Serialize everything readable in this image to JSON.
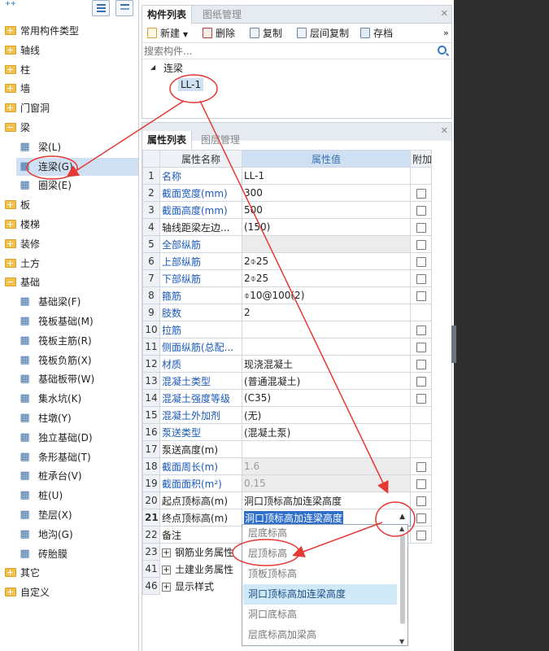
{
  "left_tree": {
    "items": [
      {
        "label": "常用构件类型",
        "kind": "folder-collapsed"
      },
      {
        "label": "轴线",
        "kind": "folder-collapsed"
      },
      {
        "label": "柱",
        "kind": "folder-collapsed"
      },
      {
        "label": "墙",
        "kind": "folder-collapsed"
      },
      {
        "label": "门窗洞",
        "kind": "folder-collapsed"
      },
      {
        "label": "梁",
        "kind": "folder-expanded"
      },
      {
        "label": "梁(L)",
        "kind": "child",
        "icon": "beam-icon"
      },
      {
        "label": "连梁(G)",
        "kind": "child",
        "icon": "link-beam-icon",
        "selected": true
      },
      {
        "label": "圈梁(E)",
        "kind": "child",
        "icon": "ring-beam-icon"
      },
      {
        "label": "板",
        "kind": "folder-collapsed"
      },
      {
        "label": "楼梯",
        "kind": "folder-collapsed"
      },
      {
        "label": "装修",
        "kind": "folder-collapsed"
      },
      {
        "label": "土方",
        "kind": "folder-collapsed"
      },
      {
        "label": "基础",
        "kind": "folder-expanded"
      },
      {
        "label": "基础梁(F)",
        "kind": "child",
        "icon": "foundation-beam-icon"
      },
      {
        "label": "筏板基础(M)",
        "kind": "child",
        "icon": "raft-foundation-icon"
      },
      {
        "label": "筏板主筋(R)",
        "kind": "child",
        "icon": "raft-main-rebar-icon"
      },
      {
        "label": "筏板负筋(X)",
        "kind": "child",
        "icon": "raft-negative-rebar-icon"
      },
      {
        "label": "基础板带(W)",
        "kind": "child",
        "icon": "foundation-strip-icon"
      },
      {
        "label": "集水坑(K)",
        "kind": "child",
        "icon": "sump-pit-icon"
      },
      {
        "label": "柱墩(Y)",
        "kind": "child",
        "icon": "column-pier-icon"
      },
      {
        "label": "独立基础(D)",
        "kind": "child",
        "icon": "isolated-footing-icon"
      },
      {
        "label": "条形基础(T)",
        "kind": "child",
        "icon": "strip-footing-icon"
      },
      {
        "label": "桩承台(V)",
        "kind": "child",
        "icon": "pile-cap-icon"
      },
      {
        "label": "桩(U)",
        "kind": "child",
        "icon": "pile-icon"
      },
      {
        "label": "垫层(X)",
        "kind": "child",
        "icon": "cushion-icon"
      },
      {
        "label": "地沟(G)",
        "kind": "child",
        "icon": "trench-icon"
      },
      {
        "label": "砖胎膜",
        "kind": "child",
        "icon": "brick-mold-icon"
      },
      {
        "label": "其它",
        "kind": "folder-collapsed"
      },
      {
        "label": "自定义",
        "kind": "folder-collapsed"
      }
    ]
  },
  "component_panel": {
    "tabs": [
      "构件列表",
      "图纸管理"
    ],
    "toolbar": {
      "new": "新建",
      "delete": "删除",
      "copy": "复制",
      "floor_copy": "层间复制",
      "archive": "存档",
      "more": "»"
    },
    "search_placeholder": "搜索构件...",
    "tree_parent": "连梁",
    "tree_child": "LL-1"
  },
  "property_panel": {
    "tabs": [
      "属性列表",
      "图层管理"
    ],
    "headers": {
      "name": "属性名称",
      "value": "属性值",
      "add": "附加"
    },
    "rows": [
      {
        "idx": "1",
        "name": "名称",
        "value": "LL-1",
        "blue": true,
        "checkbox": false
      },
      {
        "idx": "2",
        "name": "截面宽度(mm)",
        "value": "300",
        "blue": true,
        "checkbox": true
      },
      {
        "idx": "3",
        "name": "截面高度(mm)",
        "value": "500",
        "blue": true,
        "checkbox": true
      },
      {
        "idx": "4",
        "name": "轴线距梁左边...",
        "value": "(150)",
        "blue": false,
        "checkbox": true
      },
      {
        "idx": "5",
        "name": "全部纵筋",
        "value": "",
        "blue": true,
        "checkbox": true,
        "shaded": true
      },
      {
        "idx": "6",
        "name": "上部纵筋",
        "value": "2⌽25",
        "blue": true,
        "checkbox": true
      },
      {
        "idx": "7",
        "name": "下部纵筋",
        "value": "2⌽25",
        "blue": true,
        "checkbox": true
      },
      {
        "idx": "8",
        "name": "箍筋",
        "value": "⌽10@100(2)",
        "blue": true,
        "checkbox": true
      },
      {
        "idx": "9",
        "name": "肢数",
        "value": "2",
        "blue": true,
        "checkbox": false
      },
      {
        "idx": "10",
        "name": "拉筋",
        "value": "",
        "blue": true,
        "checkbox": true
      },
      {
        "idx": "11",
        "name": "侧面纵筋(总配...",
        "value": "",
        "blue": true,
        "checkbox": true
      },
      {
        "idx": "12",
        "name": "材质",
        "value": "现浇混凝土",
        "blue": true,
        "checkbox": true
      },
      {
        "idx": "13",
        "name": "混凝土类型",
        "value": "(普通混凝土)",
        "blue": true,
        "checkbox": true
      },
      {
        "idx": "14",
        "name": "混凝土强度等级",
        "value": "(C35)",
        "blue": true,
        "checkbox": true
      },
      {
        "idx": "15",
        "name": "混凝土外加剂",
        "value": "(无)",
        "blue": true,
        "checkbox": false
      },
      {
        "idx": "16",
        "name": "泵送类型",
        "value": "(混凝土泵)",
        "blue": true,
        "checkbox": false
      },
      {
        "idx": "17",
        "name": "泵送高度(m)",
        "value": "",
        "blue": false,
        "checkbox": false
      },
      {
        "idx": "18",
        "name": "截面周长(m)",
        "value": "1.6",
        "blue": true,
        "checkbox": true,
        "shaded": true,
        "gray": true
      },
      {
        "idx": "19",
        "name": "截面面积(m²)",
        "value": "0.15",
        "blue": true,
        "checkbox": true,
        "shaded": true,
        "gray": true
      },
      {
        "idx": "20",
        "name": "起点顶标高(m)",
        "value": "洞口顶标高加连梁高度",
        "blue": false,
        "checkbox": true
      },
      {
        "idx": "21",
        "name": "终点顶标高(m)",
        "value": "洞口顶标高加连梁高度",
        "blue": false,
        "checkbox": true,
        "editing": true
      },
      {
        "idx": "22",
        "name": "备注",
        "value": "",
        "blue": false,
        "checkbox": true
      },
      {
        "idx": "23",
        "name": "钢筋业务属性",
        "value": "",
        "blue": false,
        "checkbox": false,
        "group": true
      },
      {
        "idx": "41",
        "name": "土建业务属性",
        "value": "",
        "blue": false,
        "checkbox": false,
        "group": true
      },
      {
        "idx": "46",
        "name": "显示样式",
        "value": "",
        "blue": false,
        "checkbox": false,
        "group": true
      }
    ]
  },
  "dropdown": {
    "options": [
      "层底标高",
      "层顶标高",
      "顶板顶标高",
      "洞口顶标高加连梁高度",
      "洞口底标高",
      "层底标高加梁高"
    ],
    "highlighted_index": 3
  },
  "colors": {
    "accent": "#2f6fc9",
    "annotation": "#e53935",
    "selection": "#cfe0f3",
    "folder": "#f0c24b"
  }
}
